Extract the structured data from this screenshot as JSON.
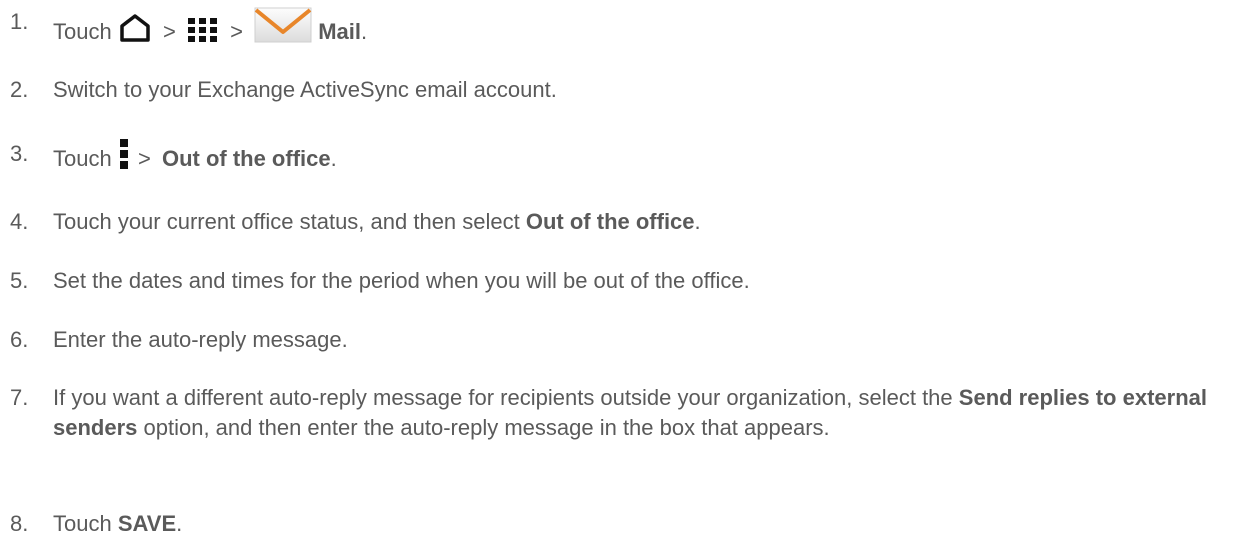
{
  "steps": [
    {
      "number": "1.",
      "touch": "Touch",
      "gt1": ">",
      "gt2": ">",
      "bold": "Mail",
      "end": ".",
      "icons": [
        "home-icon",
        "apps-grid-icon",
        "mail-envelope-icon"
      ]
    },
    {
      "number": "2.",
      "text": "Switch to your Exchange ActiveSync email account."
    },
    {
      "number": "3.",
      "touch": "Touch",
      "gt": ">",
      "bold": "Out of the office",
      "end": ".",
      "icons": [
        "overflow-menu-icon"
      ]
    },
    {
      "number": "4.",
      "before": "Touch your current office status, and then select",
      "bold": "Out of the office",
      "end": "."
    },
    {
      "number": "5.",
      "text": "Set the dates and times for the period when you will be out of the office."
    },
    {
      "number": "6.",
      "text": "Enter the auto-reply message."
    },
    {
      "number": "7.",
      "before": "If you want a different auto-reply message for recipients outside your organization, select the",
      "bold": "Send replies to external senders",
      "after": "option, and then enter the auto-reply message in the box that appears."
    },
    {
      "number": "8.",
      "touch": "Touch",
      "bold": "SAVE",
      "end": "."
    }
  ],
  "colors": {
    "text": "#5a5a5a",
    "icon_dark": "#111111",
    "envelope_orange": "#e8862a"
  }
}
